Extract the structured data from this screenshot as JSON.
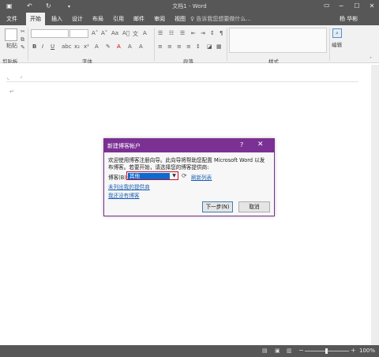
{
  "window": {
    "title": "文档1 - Word",
    "icons": [
      "save-icon",
      "undo-icon",
      "redo-icon",
      "customize-icon"
    ],
    "minimize": "−",
    "maximize": "☐",
    "close": "✕"
  },
  "tabs": [
    {
      "label": "文件"
    },
    {
      "label": "开始"
    },
    {
      "label": "插入"
    },
    {
      "label": "设计"
    },
    {
      "label": "布局"
    },
    {
      "label": "引用"
    },
    {
      "label": "邮件"
    },
    {
      "label": "审阅"
    },
    {
      "label": "视图"
    }
  ],
  "search": {
    "placeholder": "♀ 告诉我您想要做什么..."
  },
  "user": {
    "name": "杨 华彬"
  },
  "ribbon": {
    "groups": {
      "clipboard": "剪贴板",
      "font": "字体",
      "paragraph": "段落",
      "styles": "样式",
      "editing": "编辑"
    },
    "paste_label": "粘贴"
  },
  "status": {
    "zoom": "100%"
  },
  "dialog": {
    "title": "新建博客帐户",
    "help": "?",
    "close": "✕",
    "intro_line1": "欢迎使用博客注册向导。此向导将帮助您配置 Microsoft Word 以发",
    "intro_line2": "布博客。若要开始，请选择您的博客提供商:",
    "provider_label": "博客(B):",
    "provider_value": "其他",
    "refresh_link": "刷新列表",
    "unlisted_link": "未列出我的提供商",
    "no_blog_link": "我还没有博客",
    "next_button": "下一步(N)",
    "cancel_button": "取消"
  },
  "colors": {
    "titlebar": "#575757",
    "dialog_accent": "#7b3194",
    "selection": "#0a6bd1",
    "link": "#1c5fb5"
  }
}
